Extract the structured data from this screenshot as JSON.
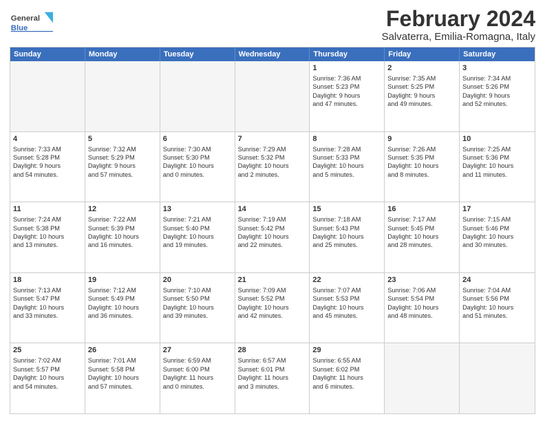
{
  "header": {
    "logo_general": "General",
    "logo_blue": "Blue",
    "title": "February 2024",
    "subtitle": "Salvaterra, Emilia-Romagna, Italy"
  },
  "days_of_week": [
    "Sunday",
    "Monday",
    "Tuesday",
    "Wednesday",
    "Thursday",
    "Friday",
    "Saturday"
  ],
  "weeks": [
    [
      {
        "day": "",
        "empty": true
      },
      {
        "day": "",
        "empty": true
      },
      {
        "day": "",
        "empty": true
      },
      {
        "day": "",
        "empty": true
      },
      {
        "day": "1",
        "lines": [
          "Sunrise: 7:36 AM",
          "Sunset: 5:23 PM",
          "Daylight: 9 hours",
          "and 47 minutes."
        ]
      },
      {
        "day": "2",
        "lines": [
          "Sunrise: 7:35 AM",
          "Sunset: 5:25 PM",
          "Daylight: 9 hours",
          "and 49 minutes."
        ]
      },
      {
        "day": "3",
        "lines": [
          "Sunrise: 7:34 AM",
          "Sunset: 5:26 PM",
          "Daylight: 9 hours",
          "and 52 minutes."
        ]
      }
    ],
    [
      {
        "day": "4",
        "lines": [
          "Sunrise: 7:33 AM",
          "Sunset: 5:28 PM",
          "Daylight: 9 hours",
          "and 54 minutes."
        ]
      },
      {
        "day": "5",
        "lines": [
          "Sunrise: 7:32 AM",
          "Sunset: 5:29 PM",
          "Daylight: 9 hours",
          "and 57 minutes."
        ]
      },
      {
        "day": "6",
        "lines": [
          "Sunrise: 7:30 AM",
          "Sunset: 5:30 PM",
          "Daylight: 10 hours",
          "and 0 minutes."
        ]
      },
      {
        "day": "7",
        "lines": [
          "Sunrise: 7:29 AM",
          "Sunset: 5:32 PM",
          "Daylight: 10 hours",
          "and 2 minutes."
        ]
      },
      {
        "day": "8",
        "lines": [
          "Sunrise: 7:28 AM",
          "Sunset: 5:33 PM",
          "Daylight: 10 hours",
          "and 5 minutes."
        ]
      },
      {
        "day": "9",
        "lines": [
          "Sunrise: 7:26 AM",
          "Sunset: 5:35 PM",
          "Daylight: 10 hours",
          "and 8 minutes."
        ]
      },
      {
        "day": "10",
        "lines": [
          "Sunrise: 7:25 AM",
          "Sunset: 5:36 PM",
          "Daylight: 10 hours",
          "and 11 minutes."
        ]
      }
    ],
    [
      {
        "day": "11",
        "lines": [
          "Sunrise: 7:24 AM",
          "Sunset: 5:38 PM",
          "Daylight: 10 hours",
          "and 13 minutes."
        ]
      },
      {
        "day": "12",
        "lines": [
          "Sunrise: 7:22 AM",
          "Sunset: 5:39 PM",
          "Daylight: 10 hours",
          "and 16 minutes."
        ]
      },
      {
        "day": "13",
        "lines": [
          "Sunrise: 7:21 AM",
          "Sunset: 5:40 PM",
          "Daylight: 10 hours",
          "and 19 minutes."
        ]
      },
      {
        "day": "14",
        "lines": [
          "Sunrise: 7:19 AM",
          "Sunset: 5:42 PM",
          "Daylight: 10 hours",
          "and 22 minutes."
        ]
      },
      {
        "day": "15",
        "lines": [
          "Sunrise: 7:18 AM",
          "Sunset: 5:43 PM",
          "Daylight: 10 hours",
          "and 25 minutes."
        ]
      },
      {
        "day": "16",
        "lines": [
          "Sunrise: 7:17 AM",
          "Sunset: 5:45 PM",
          "Daylight: 10 hours",
          "and 28 minutes."
        ]
      },
      {
        "day": "17",
        "lines": [
          "Sunrise: 7:15 AM",
          "Sunset: 5:46 PM",
          "Daylight: 10 hours",
          "and 30 minutes."
        ]
      }
    ],
    [
      {
        "day": "18",
        "lines": [
          "Sunrise: 7:13 AM",
          "Sunset: 5:47 PM",
          "Daylight: 10 hours",
          "and 33 minutes."
        ]
      },
      {
        "day": "19",
        "lines": [
          "Sunrise: 7:12 AM",
          "Sunset: 5:49 PM",
          "Daylight: 10 hours",
          "and 36 minutes."
        ]
      },
      {
        "day": "20",
        "lines": [
          "Sunrise: 7:10 AM",
          "Sunset: 5:50 PM",
          "Daylight: 10 hours",
          "and 39 minutes."
        ]
      },
      {
        "day": "21",
        "lines": [
          "Sunrise: 7:09 AM",
          "Sunset: 5:52 PM",
          "Daylight: 10 hours",
          "and 42 minutes."
        ]
      },
      {
        "day": "22",
        "lines": [
          "Sunrise: 7:07 AM",
          "Sunset: 5:53 PM",
          "Daylight: 10 hours",
          "and 45 minutes."
        ]
      },
      {
        "day": "23",
        "lines": [
          "Sunrise: 7:06 AM",
          "Sunset: 5:54 PM",
          "Daylight: 10 hours",
          "and 48 minutes."
        ]
      },
      {
        "day": "24",
        "lines": [
          "Sunrise: 7:04 AM",
          "Sunset: 5:56 PM",
          "Daylight: 10 hours",
          "and 51 minutes."
        ]
      }
    ],
    [
      {
        "day": "25",
        "lines": [
          "Sunrise: 7:02 AM",
          "Sunset: 5:57 PM",
          "Daylight: 10 hours",
          "and 54 minutes."
        ]
      },
      {
        "day": "26",
        "lines": [
          "Sunrise: 7:01 AM",
          "Sunset: 5:58 PM",
          "Daylight: 10 hours",
          "and 57 minutes."
        ]
      },
      {
        "day": "27",
        "lines": [
          "Sunrise: 6:59 AM",
          "Sunset: 6:00 PM",
          "Daylight: 11 hours",
          "and 0 minutes."
        ]
      },
      {
        "day": "28",
        "lines": [
          "Sunrise: 6:57 AM",
          "Sunset: 6:01 PM",
          "Daylight: 11 hours",
          "and 3 minutes."
        ]
      },
      {
        "day": "29",
        "lines": [
          "Sunrise: 6:55 AM",
          "Sunset: 6:02 PM",
          "Daylight: 11 hours",
          "and 6 minutes."
        ]
      },
      {
        "day": "",
        "empty": true
      },
      {
        "day": "",
        "empty": true
      }
    ]
  ]
}
